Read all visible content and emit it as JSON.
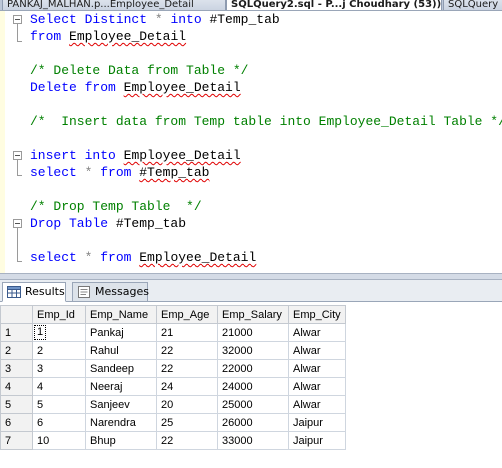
{
  "tabs": [
    {
      "label": "PANKAJ_MALHAN.p...Employee_Detail",
      "active": false
    },
    {
      "label": "SQLQuery2.sql - P...j Choudhary (53))*",
      "active": true
    },
    {
      "label": "SQLQuery",
      "active": false
    }
  ],
  "editor": {
    "lines": {
      "l1": {
        "k1": "Select Distinct",
        "g1": " * ",
        "k2": "into",
        "t1": " #Temp_tab"
      },
      "l2": {
        "k1": "from",
        "t1": " ",
        "s1": "Employee_Detail"
      },
      "l3": {
        "c1": "/* Delete Data from Table */"
      },
      "l4": {
        "k1": "Delete from",
        "t1": " ",
        "s1": "Employee_Detail"
      },
      "l5": {
        "c1": "/*  Insert data from Temp table into Employee_Detail Table */"
      },
      "l6": {
        "k1": "insert into",
        "t1": " ",
        "s1": "Employee_Detail"
      },
      "l7": {
        "k1": "select",
        "g1": " * ",
        "k2": "from",
        "t1": " ",
        "s1": "#Temp_tab"
      },
      "l8": {
        "c1": "/* Drop Temp Table  */"
      },
      "l9": {
        "k1": "Drop Table",
        "t1": " #Temp_tab"
      },
      "l10": {
        "k1": "select",
        "g1": " * ",
        "k2": "from",
        "t1": " ",
        "s1": "Employee_Detail"
      }
    }
  },
  "results_tabs": {
    "results": "Results",
    "messages": "Messages"
  },
  "grid": {
    "columns": [
      "Emp_Id",
      "Emp_Name",
      "Emp_Age",
      "Emp_Salary",
      "Emp_City"
    ],
    "rows": [
      {
        "rn": "1",
        "cells": [
          "1",
          "Pankaj",
          "21",
          "21000",
          "Alwar"
        ]
      },
      {
        "rn": "2",
        "cells": [
          "2",
          "Rahul",
          "22",
          "32000",
          "Alwar"
        ]
      },
      {
        "rn": "3",
        "cells": [
          "3",
          "Sandeep",
          "22",
          "22000",
          "Alwar"
        ]
      },
      {
        "rn": "4",
        "cells": [
          "4",
          "Neeraj",
          "24",
          "24000",
          "Alwar"
        ]
      },
      {
        "rn": "5",
        "cells": [
          "5",
          "Sanjeev",
          "20",
          "25000",
          "Alwar"
        ]
      },
      {
        "rn": "6",
        "cells": [
          "6",
          "Narendra",
          "25",
          "26000",
          "Jaipur"
        ]
      },
      {
        "rn": "7",
        "cells": [
          "10",
          "Bhup",
          "22",
          "33000",
          "Jaipur"
        ]
      }
    ]
  },
  "colors": {
    "keyword": "#0000ff",
    "comment": "#008000",
    "squiggle": "#e00000"
  }
}
